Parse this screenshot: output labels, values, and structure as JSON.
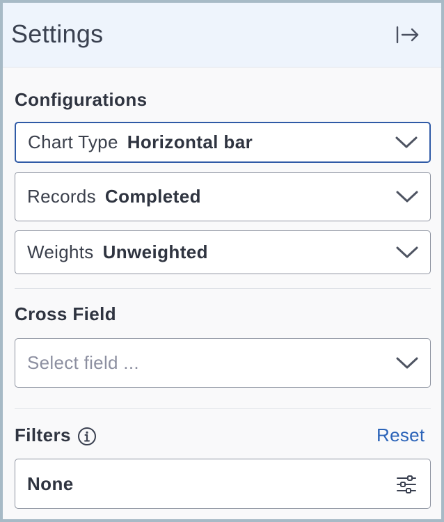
{
  "panel": {
    "title": "Settings",
    "collapse_icon": "collapse-right-icon"
  },
  "configurations": {
    "heading": "Configurations",
    "chart_type": {
      "label": "Chart Type",
      "value": "Horizontal bar"
    },
    "records": {
      "label": "Records",
      "value": "Completed"
    },
    "weights": {
      "label": "Weights",
      "value": "Unweighted"
    }
  },
  "cross_field": {
    "heading": "Cross Field",
    "placeholder": "Select field ..."
  },
  "filters": {
    "heading": "Filters",
    "info_icon": "info-icon",
    "reset_label": "Reset",
    "value": "None",
    "filter_icon": "sliders-icon"
  },
  "colors": {
    "accent": "#2b63b8",
    "focus_border": "#2f5aa6",
    "header_bg": "#eef4fc",
    "panel_bg": "#f9f9fa",
    "text_dark": "#2f3440"
  }
}
